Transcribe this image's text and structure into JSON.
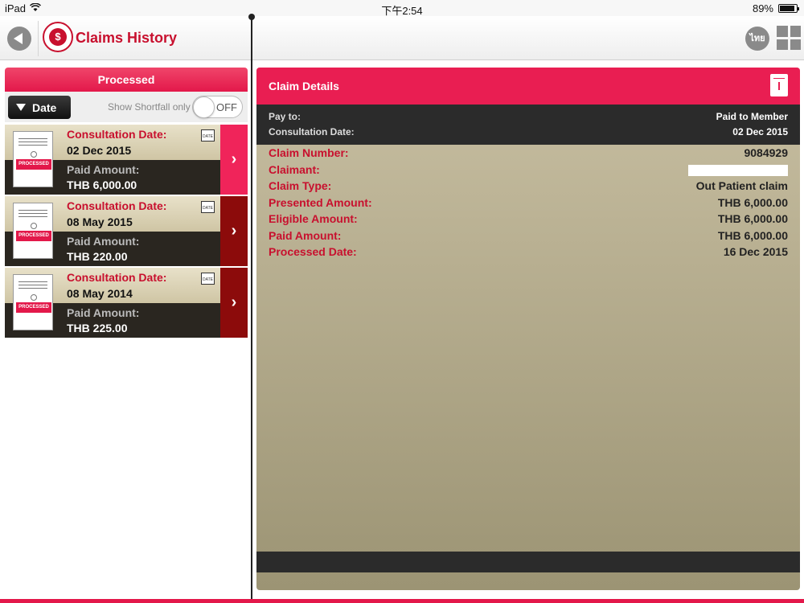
{
  "status_bar": {
    "device": "iPad",
    "time": "下午2:54",
    "battery": "89%",
    "battery_level_percent": 89
  },
  "header": {
    "title": "Claims History",
    "claims_icon_glyph": "$",
    "lang_button": "ไทย"
  },
  "left": {
    "tab": "Processed",
    "sort_label": "Date",
    "shortfall_label": "Show Shortfall only",
    "toggle_label": "OFF",
    "cards": [
      {
        "date_label": "Consultation Date:",
        "date": "02 Dec 2015",
        "amount_label": "Paid Amount:",
        "amount": "THB 6,000.00",
        "stamp": "PROCESSED",
        "cal": "DATE"
      },
      {
        "date_label": "Consultation Date:",
        "date": "08 May 2015",
        "amount_label": "Paid Amount:",
        "amount": "THB 220.00",
        "stamp": "PROCESSED",
        "cal": "DATE"
      },
      {
        "date_label": "Consultation Date:",
        "date": "08 May 2014",
        "amount_label": "Paid Amount:",
        "amount": "THB 225.00",
        "stamp": "PROCESSED",
        "cal": "DATE"
      }
    ]
  },
  "details": {
    "title": "Claim Details",
    "pay_to_label": "Pay to:",
    "pay_to": "Paid to Member",
    "consult_label": "Consultation Date:",
    "consult": "02 Dec 2015",
    "rows": [
      {
        "label": "Claim Number:",
        "value": "9084929"
      },
      {
        "label": "Claimant:",
        "value": ""
      },
      {
        "label": "Claim Type:",
        "value": "Out Patient claim"
      },
      {
        "label": "Presented Amount:",
        "value": "THB 6,000.00"
      },
      {
        "label": "Eligible Amount:",
        "value": "THB 6,000.00"
      },
      {
        "label": "Paid Amount:",
        "value": "THB 6,000.00"
      },
      {
        "label": "Processed Date:",
        "value": "16 Dec 2015"
      }
    ]
  },
  "colors": {
    "accent": "#e91e52",
    "brand_red": "#c8102e",
    "dark": "#2b2b2b",
    "selected_arrow": "#f0245a",
    "arrow": "#8c0b0b"
  }
}
